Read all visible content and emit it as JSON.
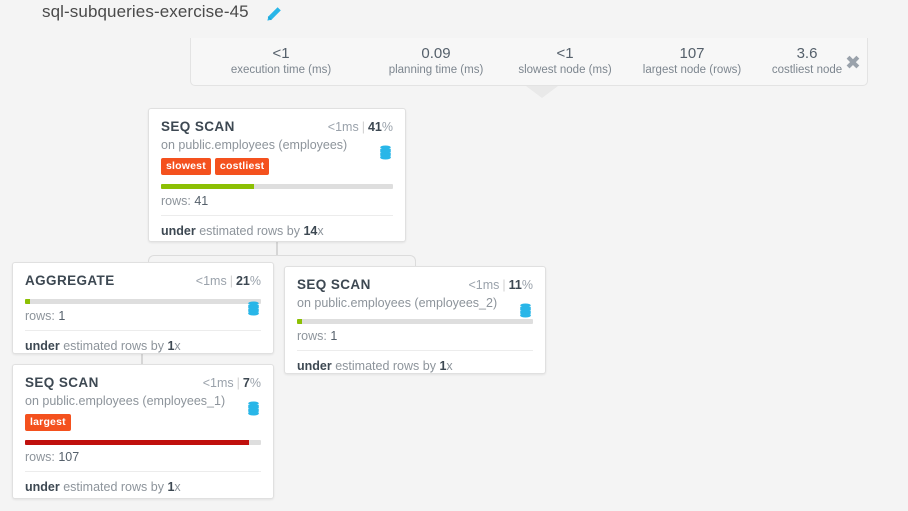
{
  "header": {
    "plan_title": "sql-subqueries-exercise-45",
    "edit_icon": "pencil-icon"
  },
  "stats": {
    "close_label": "✖",
    "items": [
      {
        "value": "<1",
        "label": "execution time (ms)"
      },
      {
        "value": "0.09",
        "label": "planning time (ms)"
      },
      {
        "value": "<1",
        "label": "slowest node (ms)"
      },
      {
        "value": "107",
        "label": "largest node (rows)"
      },
      {
        "value": "3.6",
        "label": "costliest node"
      }
    ]
  },
  "colors": {
    "badge": "#f4511e",
    "bar_green": "#8cc004",
    "bar_red": "#c0100d",
    "bar_track": "#dedede",
    "accent_blue": "#29b6e8"
  },
  "nodes": [
    {
      "id": "seq-scan-employees",
      "type": "SEQ SCAN",
      "time": "<1ms",
      "separator": "|",
      "percent": "41",
      "percent_symbol": "%",
      "subtitle": "on public.employees (employees)",
      "badges": [
        "slowest",
        "costliest"
      ],
      "bar_percent": 40,
      "bar_color": "#8cc004",
      "rows_label": "rows:",
      "rows_value": "41",
      "estimate_prefix": "under",
      "estimate_text": "estimated rows by",
      "estimate_factor": "14",
      "estimate_suffix": "x",
      "icon": "database-icon"
    },
    {
      "id": "aggregate",
      "type": "AGGREGATE",
      "time": "<1ms",
      "separator": "|",
      "percent": "21",
      "percent_symbol": "%",
      "subtitle": "",
      "badges": [],
      "bar_percent": 2,
      "bar_color": "#8cc004",
      "rows_label": "rows:",
      "rows_value": "1",
      "estimate_prefix": "under",
      "estimate_text": "estimated rows by",
      "estimate_factor": "1",
      "estimate_suffix": "x",
      "icon": "database-icon"
    },
    {
      "id": "seq-scan-employees-2",
      "type": "SEQ SCAN",
      "time": "<1ms",
      "separator": "|",
      "percent": "11",
      "percent_symbol": "%",
      "subtitle": "on public.employees (employees_2)",
      "badges": [],
      "bar_percent": 2,
      "bar_color": "#8cc004",
      "rows_label": "rows:",
      "rows_value": "1",
      "estimate_prefix": "under",
      "estimate_text": "estimated rows by",
      "estimate_factor": "1",
      "estimate_suffix": "x",
      "icon": "database-icon"
    },
    {
      "id": "seq-scan-employees-1",
      "type": "SEQ SCAN",
      "time": "<1ms",
      "separator": "|",
      "percent": "7",
      "percent_symbol": "%",
      "subtitle": "on public.employees (employees_1)",
      "badges": [
        "largest"
      ],
      "bar_percent": 95,
      "bar_color": "#c0100d",
      "rows_label": "rows:",
      "rows_value": "107",
      "estimate_prefix": "under",
      "estimate_text": "estimated rows by",
      "estimate_factor": "1",
      "estimate_suffix": "x",
      "icon": "database-icon"
    }
  ]
}
